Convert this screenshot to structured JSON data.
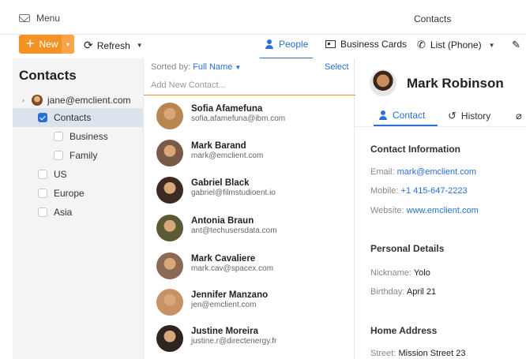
{
  "top": {
    "menu_label": "Menu",
    "app_title": "Contacts"
  },
  "toolbar": {
    "new_label": "New",
    "refresh_label": "Refresh",
    "views": [
      {
        "label": "People",
        "icon": "person-icon",
        "active": true
      },
      {
        "label": "Business Cards",
        "icon": "business-card-icon"
      },
      {
        "label": "List (Phone)",
        "icon": "phone-icon"
      }
    ],
    "accent": "#f39325"
  },
  "left": {
    "title": "Contacts",
    "account": "jane@emclient.com",
    "folders": [
      {
        "label": "Contacts",
        "checked": true,
        "selected": true
      },
      {
        "label": "Business",
        "checked": false
      },
      {
        "label": "Family",
        "checked": false
      },
      {
        "label": "US",
        "checked": false
      },
      {
        "label": "Europe",
        "checked": false
      },
      {
        "label": "Asia",
        "checked": false
      }
    ]
  },
  "list": {
    "sorted_prefix": "Sorted by:",
    "sorted_value": "Full Name",
    "select_label": "Select",
    "add_placeholder": "Add New Contact...",
    "contacts": [
      {
        "name": "Sofia Afamefuna",
        "email": "sofia.afamefuna@ibm.com",
        "color": "#b8874f"
      },
      {
        "name": "Mark Barand",
        "email": "mark@emclient.com",
        "color": "#7a5a46"
      },
      {
        "name": "Gabriel Black",
        "email": "gabriel@filmstudioent.io",
        "color": "#3d2a22"
      },
      {
        "name": "Antonia Braun",
        "email": "ant@techusersdata.com",
        "color": "#5b5a34"
      },
      {
        "name": "Mark Cavaliere",
        "email": "mark.cav@spacex.com",
        "color": "#8a6a55"
      },
      {
        "name": "Jennifer Manzano",
        "email": "jen@emclient.com",
        "color": "#c79366"
      },
      {
        "name": "Justine Moreira",
        "email": "justine.r@directenergy.fr",
        "color": "#2f2520"
      }
    ]
  },
  "detail": {
    "name": "Mark Robinson",
    "tabs": [
      {
        "label": "Contact",
        "active": true
      },
      {
        "label": "History"
      }
    ],
    "contact_info_title": "Contact Information",
    "email_label": "Email:",
    "email": "mark@emclient.com",
    "mobile_label": "Mobile:",
    "mobile": "+1 415-647-2223",
    "website_label": "Website:",
    "website": "www.emclient.com",
    "personal_title": "Personal Details",
    "nickname_label": "Nickname:",
    "nickname": "Yolo",
    "birthday_label": "Birthday:",
    "birthday": "April 21",
    "home_title": "Home Address",
    "street_label": "Street:",
    "street": "Mission Street 23"
  }
}
